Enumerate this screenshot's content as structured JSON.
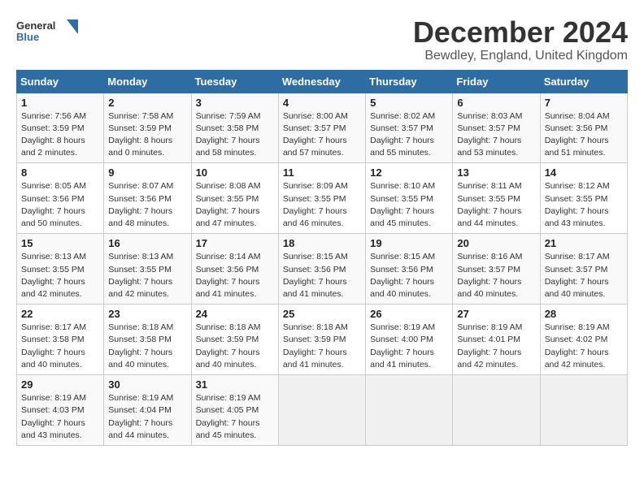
{
  "header": {
    "logo_line1": "General",
    "logo_line2": "Blue",
    "title": "December 2024",
    "subtitle": "Bewdley, England, United Kingdom"
  },
  "weekdays": [
    "Sunday",
    "Monday",
    "Tuesday",
    "Wednesday",
    "Thursday",
    "Friday",
    "Saturday"
  ],
  "weeks": [
    [
      {
        "day": "1",
        "sunrise": "7:56 AM",
        "sunset": "3:59 PM",
        "daylight": "8 hours and 2 minutes."
      },
      {
        "day": "2",
        "sunrise": "7:58 AM",
        "sunset": "3:59 PM",
        "daylight": "8 hours and 0 minutes."
      },
      {
        "day": "3",
        "sunrise": "7:59 AM",
        "sunset": "3:58 PM",
        "daylight": "7 hours and 58 minutes."
      },
      {
        "day": "4",
        "sunrise": "8:00 AM",
        "sunset": "3:57 PM",
        "daylight": "7 hours and 57 minutes."
      },
      {
        "day": "5",
        "sunrise": "8:02 AM",
        "sunset": "3:57 PM",
        "daylight": "7 hours and 55 minutes."
      },
      {
        "day": "6",
        "sunrise": "8:03 AM",
        "sunset": "3:57 PM",
        "daylight": "7 hours and 53 minutes."
      },
      {
        "day": "7",
        "sunrise": "8:04 AM",
        "sunset": "3:56 PM",
        "daylight": "7 hours and 51 minutes."
      }
    ],
    [
      {
        "day": "8",
        "sunrise": "8:05 AM",
        "sunset": "3:56 PM",
        "daylight": "7 hours and 50 minutes."
      },
      {
        "day": "9",
        "sunrise": "8:07 AM",
        "sunset": "3:56 PM",
        "daylight": "7 hours and 48 minutes."
      },
      {
        "day": "10",
        "sunrise": "8:08 AM",
        "sunset": "3:55 PM",
        "daylight": "7 hours and 47 minutes."
      },
      {
        "day": "11",
        "sunrise": "8:09 AM",
        "sunset": "3:55 PM",
        "daylight": "7 hours and 46 minutes."
      },
      {
        "day": "12",
        "sunrise": "8:10 AM",
        "sunset": "3:55 PM",
        "daylight": "7 hours and 45 minutes."
      },
      {
        "day": "13",
        "sunrise": "8:11 AM",
        "sunset": "3:55 PM",
        "daylight": "7 hours and 44 minutes."
      },
      {
        "day": "14",
        "sunrise": "8:12 AM",
        "sunset": "3:55 PM",
        "daylight": "7 hours and 43 minutes."
      }
    ],
    [
      {
        "day": "15",
        "sunrise": "8:13 AM",
        "sunset": "3:55 PM",
        "daylight": "7 hours and 42 minutes."
      },
      {
        "day": "16",
        "sunrise": "8:13 AM",
        "sunset": "3:55 PM",
        "daylight": "7 hours and 42 minutes."
      },
      {
        "day": "17",
        "sunrise": "8:14 AM",
        "sunset": "3:56 PM",
        "daylight": "7 hours and 41 minutes."
      },
      {
        "day": "18",
        "sunrise": "8:15 AM",
        "sunset": "3:56 PM",
        "daylight": "7 hours and 41 minutes."
      },
      {
        "day": "19",
        "sunrise": "8:15 AM",
        "sunset": "3:56 PM",
        "daylight": "7 hours and 40 minutes."
      },
      {
        "day": "20",
        "sunrise": "8:16 AM",
        "sunset": "3:57 PM",
        "daylight": "7 hours and 40 minutes."
      },
      {
        "day": "21",
        "sunrise": "8:17 AM",
        "sunset": "3:57 PM",
        "daylight": "7 hours and 40 minutes."
      }
    ],
    [
      {
        "day": "22",
        "sunrise": "8:17 AM",
        "sunset": "3:58 PM",
        "daylight": "7 hours and 40 minutes."
      },
      {
        "day": "23",
        "sunrise": "8:18 AM",
        "sunset": "3:58 PM",
        "daylight": "7 hours and 40 minutes."
      },
      {
        "day": "24",
        "sunrise": "8:18 AM",
        "sunset": "3:59 PM",
        "daylight": "7 hours and 40 minutes."
      },
      {
        "day": "25",
        "sunrise": "8:18 AM",
        "sunset": "3:59 PM",
        "daylight": "7 hours and 41 minutes."
      },
      {
        "day": "26",
        "sunrise": "8:19 AM",
        "sunset": "4:00 PM",
        "daylight": "7 hours and 41 minutes."
      },
      {
        "day": "27",
        "sunrise": "8:19 AM",
        "sunset": "4:01 PM",
        "daylight": "7 hours and 42 minutes."
      },
      {
        "day": "28",
        "sunrise": "8:19 AM",
        "sunset": "4:02 PM",
        "daylight": "7 hours and 42 minutes."
      }
    ],
    [
      {
        "day": "29",
        "sunrise": "8:19 AM",
        "sunset": "4:03 PM",
        "daylight": "7 hours and 43 minutes."
      },
      {
        "day": "30",
        "sunrise": "8:19 AM",
        "sunset": "4:04 PM",
        "daylight": "7 hours and 44 minutes."
      },
      {
        "day": "31",
        "sunrise": "8:19 AM",
        "sunset": "4:05 PM",
        "daylight": "7 hours and 45 minutes."
      },
      null,
      null,
      null,
      null
    ]
  ]
}
